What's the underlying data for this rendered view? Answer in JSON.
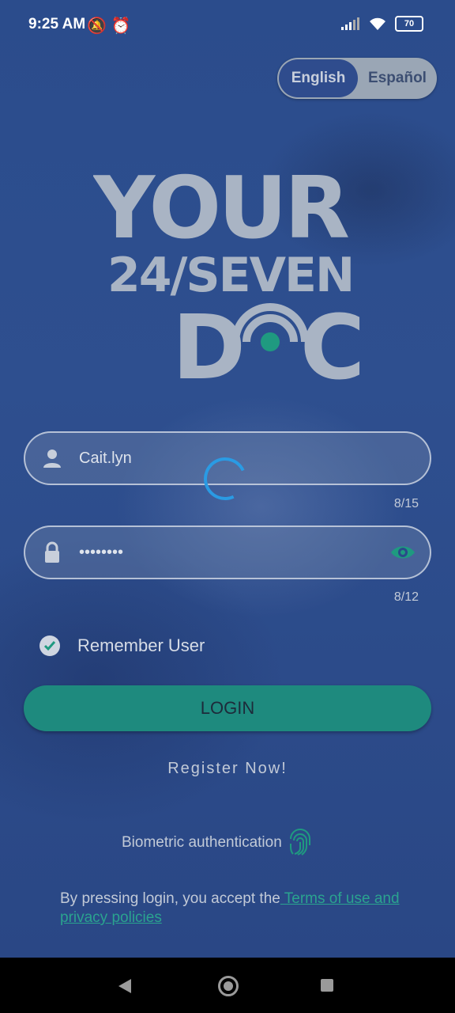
{
  "status_bar": {
    "time": "9:25 AM",
    "battery": "70"
  },
  "language_toggle": {
    "option_english": "English",
    "option_spanish": "Español",
    "selected": "English"
  },
  "logo": {
    "line1": "YOUR",
    "line2": "24/SEVEN",
    "line3_left": "D",
    "line3_right": "C"
  },
  "username_field": {
    "value": "Cait.lyn",
    "counter": "8/15"
  },
  "password_field": {
    "value": "••••••••",
    "counter": "8/12"
  },
  "remember_user": {
    "label": "Remember User",
    "checked": true
  },
  "login_button": {
    "label": "LOGIN"
  },
  "register_link": {
    "label": "Register Now!"
  },
  "biometric": {
    "label": "Biometric authentication"
  },
  "terms": {
    "prefix": "By pressing login, you accept the",
    "link": " Terms of use and privacy policies "
  },
  "colors": {
    "accent": "#1e8a7e",
    "link": "#2aa38f",
    "background": "#2a4a8a"
  }
}
